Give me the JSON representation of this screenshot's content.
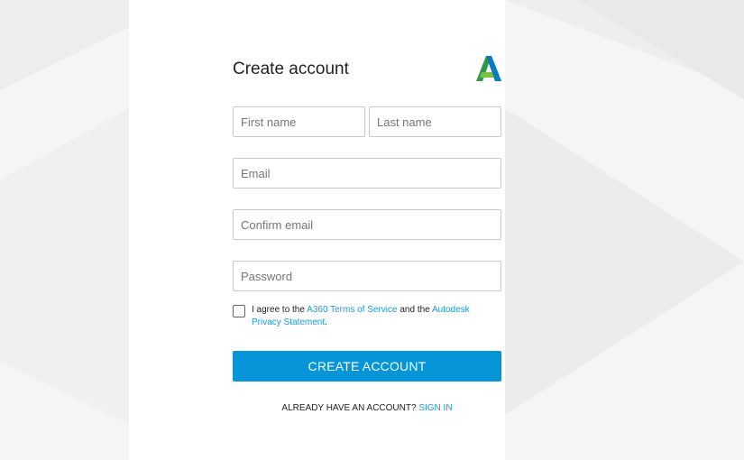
{
  "form": {
    "title": "Create account",
    "first_name_placeholder": "First name",
    "last_name_placeholder": "Last name",
    "email_placeholder": "Email",
    "confirm_email_placeholder": "Confirm email",
    "password_placeholder": "Password",
    "agree": {
      "prefix": "I agree to the ",
      "terms_link": "A360 Terms of Service",
      "middle": " and the ",
      "privacy_link": "Autodesk Privacy Statement",
      "suffix": "."
    },
    "submit_label": "CREATE ACCOUNT",
    "signin_prompt": "ALREADY HAVE AN ACCOUNT? ",
    "signin_link": "SIGN IN"
  },
  "logo": {
    "icon": "autodesk-logo-icon"
  },
  "colors": {
    "accent": "#0696d7",
    "link": "#1a9bd7",
    "background": "#f5f5f5",
    "card": "#ffffff"
  }
}
